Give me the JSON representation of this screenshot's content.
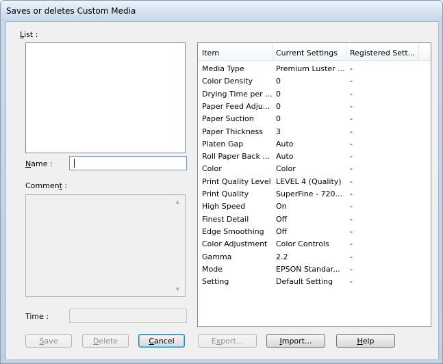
{
  "window": {
    "title": "Saves or deletes Custom Media"
  },
  "labels": {
    "list": "List :",
    "list_u": "L",
    "list_rest": "ist :",
    "name_u": "N",
    "name_rest": "ame :",
    "comment_pre": "Commen",
    "comment_u": "t",
    "comment_rest": " :",
    "time": "Time :"
  },
  "name_field": {
    "value": ""
  },
  "table": {
    "headers": [
      "Item",
      "Current Settings",
      "Registered Sett..."
    ],
    "rows": [
      [
        "Media Type",
        "Premium Luster ...",
        "-"
      ],
      [
        "Color Density",
        "0",
        "-"
      ],
      [
        "Drying Time per ...",
        "0",
        "-"
      ],
      [
        "Paper Feed Adju...",
        "0",
        "-"
      ],
      [
        "Paper Suction",
        "0",
        "-"
      ],
      [
        "Paper Thickness",
        "3",
        "-"
      ],
      [
        "Platen Gap",
        "Auto",
        "-"
      ],
      [
        "Roll Paper Back ...",
        "Auto",
        "-"
      ],
      [
        "Color",
        "Color",
        "-"
      ],
      [
        "Print Quality Level",
        "LEVEL 4 (Quality)",
        "-"
      ],
      [
        "Print Quality",
        "SuperFine - 720...",
        "-"
      ],
      [
        "High Speed",
        "On",
        "-"
      ],
      [
        "Finest Detail",
        "Off",
        "-"
      ],
      [
        "Edge Smoothing",
        "Off",
        "-"
      ],
      [
        "Color Adjustment",
        "Color Controls",
        "-"
      ],
      [
        "Gamma",
        "2.2",
        "-"
      ],
      [
        "Mode",
        "EPSON Standar...",
        "-"
      ],
      [
        "Setting",
        "Default Setting",
        "-"
      ]
    ]
  },
  "buttons": {
    "save_u": "S",
    "save_rest": "ave",
    "delete_u": "D",
    "delete_rest": "elete",
    "cancel_u": "C",
    "cancel_rest": "ancel",
    "export_pre": "E",
    "export_u": "x",
    "export_rest": "port...",
    "import_u": "I",
    "import_rest": "mport...",
    "help_u": "H",
    "help_rest": "elp"
  }
}
